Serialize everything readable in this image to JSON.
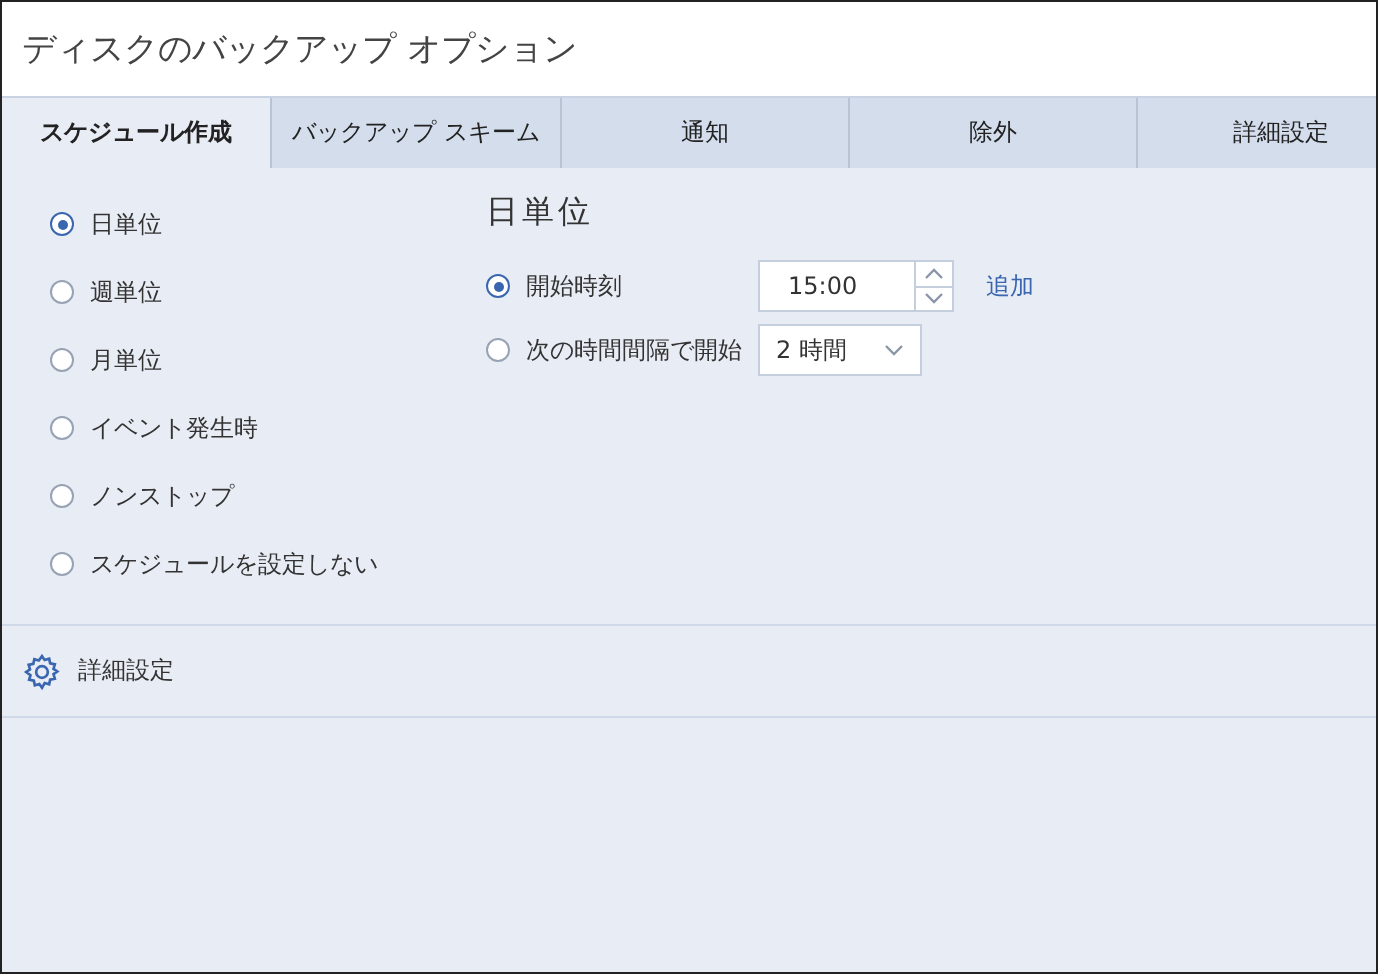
{
  "window": {
    "title": "ディスクのバックアップ オプション"
  },
  "tabs": [
    {
      "label": "スケジュール作成",
      "selected": true
    },
    {
      "label": "バックアップ スキーム",
      "selected": false
    },
    {
      "label": "通知",
      "selected": false
    },
    {
      "label": "除外",
      "selected": false
    },
    {
      "label": "詳細設定",
      "selected": false
    }
  ],
  "schedule_types": [
    {
      "label": "日単位",
      "selected": true
    },
    {
      "label": "週単位",
      "selected": false
    },
    {
      "label": "月単位",
      "selected": false
    },
    {
      "label": "イベント発生時",
      "selected": false
    },
    {
      "label": "ノンストップ",
      "selected": false
    },
    {
      "label": "スケジュールを設定しない",
      "selected": false
    }
  ],
  "detail": {
    "heading": "日単位",
    "start_time": {
      "label": "開始時刻",
      "selected": true,
      "value": "15:00",
      "add_link": "追加"
    },
    "interval": {
      "label": "次の時間間隔で開始",
      "selected": false,
      "value": "2 時間"
    }
  },
  "advanced": {
    "label": "詳細設定"
  }
}
